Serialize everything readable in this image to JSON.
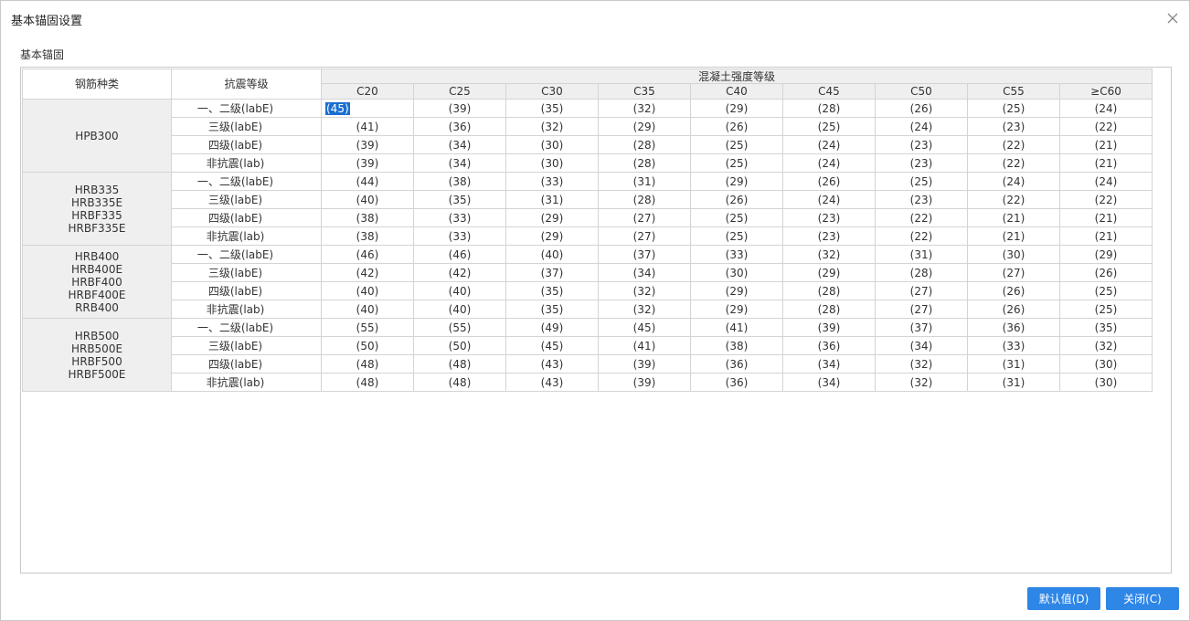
{
  "window": {
    "title": "基本锚固设置"
  },
  "section_label": "基本锚固",
  "table": {
    "col_rebar_type": "钢筋种类",
    "col_seismic_grade": "抗震等级",
    "concrete_group_header": "混凝土强度等级",
    "concrete_grades": [
      "C20",
      "C25",
      "C30",
      "C35",
      "C40",
      "C45",
      "C50",
      "C55",
      "≥C60"
    ],
    "groups": [
      {
        "types": [
          "HPB300"
        ],
        "rows": [
          {
            "grade": "一、二级(labE)",
            "values": [
              "(45)",
              "(39)",
              "(35)",
              "(32)",
              "(29)",
              "(28)",
              "(26)",
              "(25)",
              "(24)"
            ]
          },
          {
            "grade": "三级(labE)",
            "values": [
              "(41)",
              "(36)",
              "(32)",
              "(29)",
              "(26)",
              "(25)",
              "(24)",
              "(23)",
              "(22)"
            ]
          },
          {
            "grade": "四级(labE)",
            "values": [
              "(39)",
              "(34)",
              "(30)",
              "(28)",
              "(25)",
              "(24)",
              "(23)",
              "(22)",
              "(21)"
            ]
          },
          {
            "grade": "非抗震(lab)",
            "values": [
              "(39)",
              "(34)",
              "(30)",
              "(28)",
              "(25)",
              "(24)",
              "(23)",
              "(22)",
              "(21)"
            ]
          }
        ]
      },
      {
        "types": [
          "HRB335",
          "HRB335E",
          "HRBF335",
          "HRBF335E"
        ],
        "rows": [
          {
            "grade": "一、二级(labE)",
            "values": [
              "(44)",
              "(38)",
              "(33)",
              "(31)",
              "(29)",
              "(26)",
              "(25)",
              "(24)",
              "(24)"
            ]
          },
          {
            "grade": "三级(labE)",
            "values": [
              "(40)",
              "(35)",
              "(31)",
              "(28)",
              "(26)",
              "(24)",
              "(23)",
              "(22)",
              "(22)"
            ]
          },
          {
            "grade": "四级(labE)",
            "values": [
              "(38)",
              "(33)",
              "(29)",
              "(27)",
              "(25)",
              "(23)",
              "(22)",
              "(21)",
              "(21)"
            ]
          },
          {
            "grade": "非抗震(lab)",
            "values": [
              "(38)",
              "(33)",
              "(29)",
              "(27)",
              "(25)",
              "(23)",
              "(22)",
              "(21)",
              "(21)"
            ]
          }
        ]
      },
      {
        "types": [
          "HRB400",
          "HRB400E",
          "HRBF400",
          "HRBF400E",
          "RRB400"
        ],
        "rows": [
          {
            "grade": "一、二级(labE)",
            "values": [
              "(46)",
              "(46)",
              "(40)",
              "(37)",
              "(33)",
              "(32)",
              "(31)",
              "(30)",
              "(29)"
            ]
          },
          {
            "grade": "三级(labE)",
            "values": [
              "(42)",
              "(42)",
              "(37)",
              "(34)",
              "(30)",
              "(29)",
              "(28)",
              "(27)",
              "(26)"
            ]
          },
          {
            "grade": "四级(labE)",
            "values": [
              "(40)",
              "(40)",
              "(35)",
              "(32)",
              "(29)",
              "(28)",
              "(27)",
              "(26)",
              "(25)"
            ]
          },
          {
            "grade": "非抗震(lab)",
            "values": [
              "(40)",
              "(40)",
              "(35)",
              "(32)",
              "(29)",
              "(28)",
              "(27)",
              "(26)",
              "(25)"
            ]
          }
        ]
      },
      {
        "types": [
          "HRB500",
          "HRB500E",
          "HRBF500",
          "HRBF500E"
        ],
        "rows": [
          {
            "grade": "一、二级(labE)",
            "values": [
              "(55)",
              "(55)",
              "(49)",
              "(45)",
              "(41)",
              "(39)",
              "(37)",
              "(36)",
              "(35)"
            ]
          },
          {
            "grade": "三级(labE)",
            "values": [
              "(50)",
              "(50)",
              "(45)",
              "(41)",
              "(38)",
              "(36)",
              "(34)",
              "(33)",
              "(32)"
            ]
          },
          {
            "grade": "四级(labE)",
            "values": [
              "(48)",
              "(48)",
              "(43)",
              "(39)",
              "(36)",
              "(34)",
              "(32)",
              "(31)",
              "(30)"
            ]
          },
          {
            "grade": "非抗震(lab)",
            "values": [
              "(48)",
              "(48)",
              "(43)",
              "(39)",
              "(36)",
              "(34)",
              "(32)",
              "(31)",
              "(30)"
            ]
          }
        ]
      }
    ]
  },
  "buttons": {
    "default_label": "默认值(D)",
    "close_label": "关闭(C)"
  },
  "icons": {
    "close": "close-icon"
  },
  "colors": {
    "accent": "#2e86e6",
    "selection": "#1a6fd1",
    "header_bg": "#efefef",
    "grid_line": "#d4d4d4"
  }
}
